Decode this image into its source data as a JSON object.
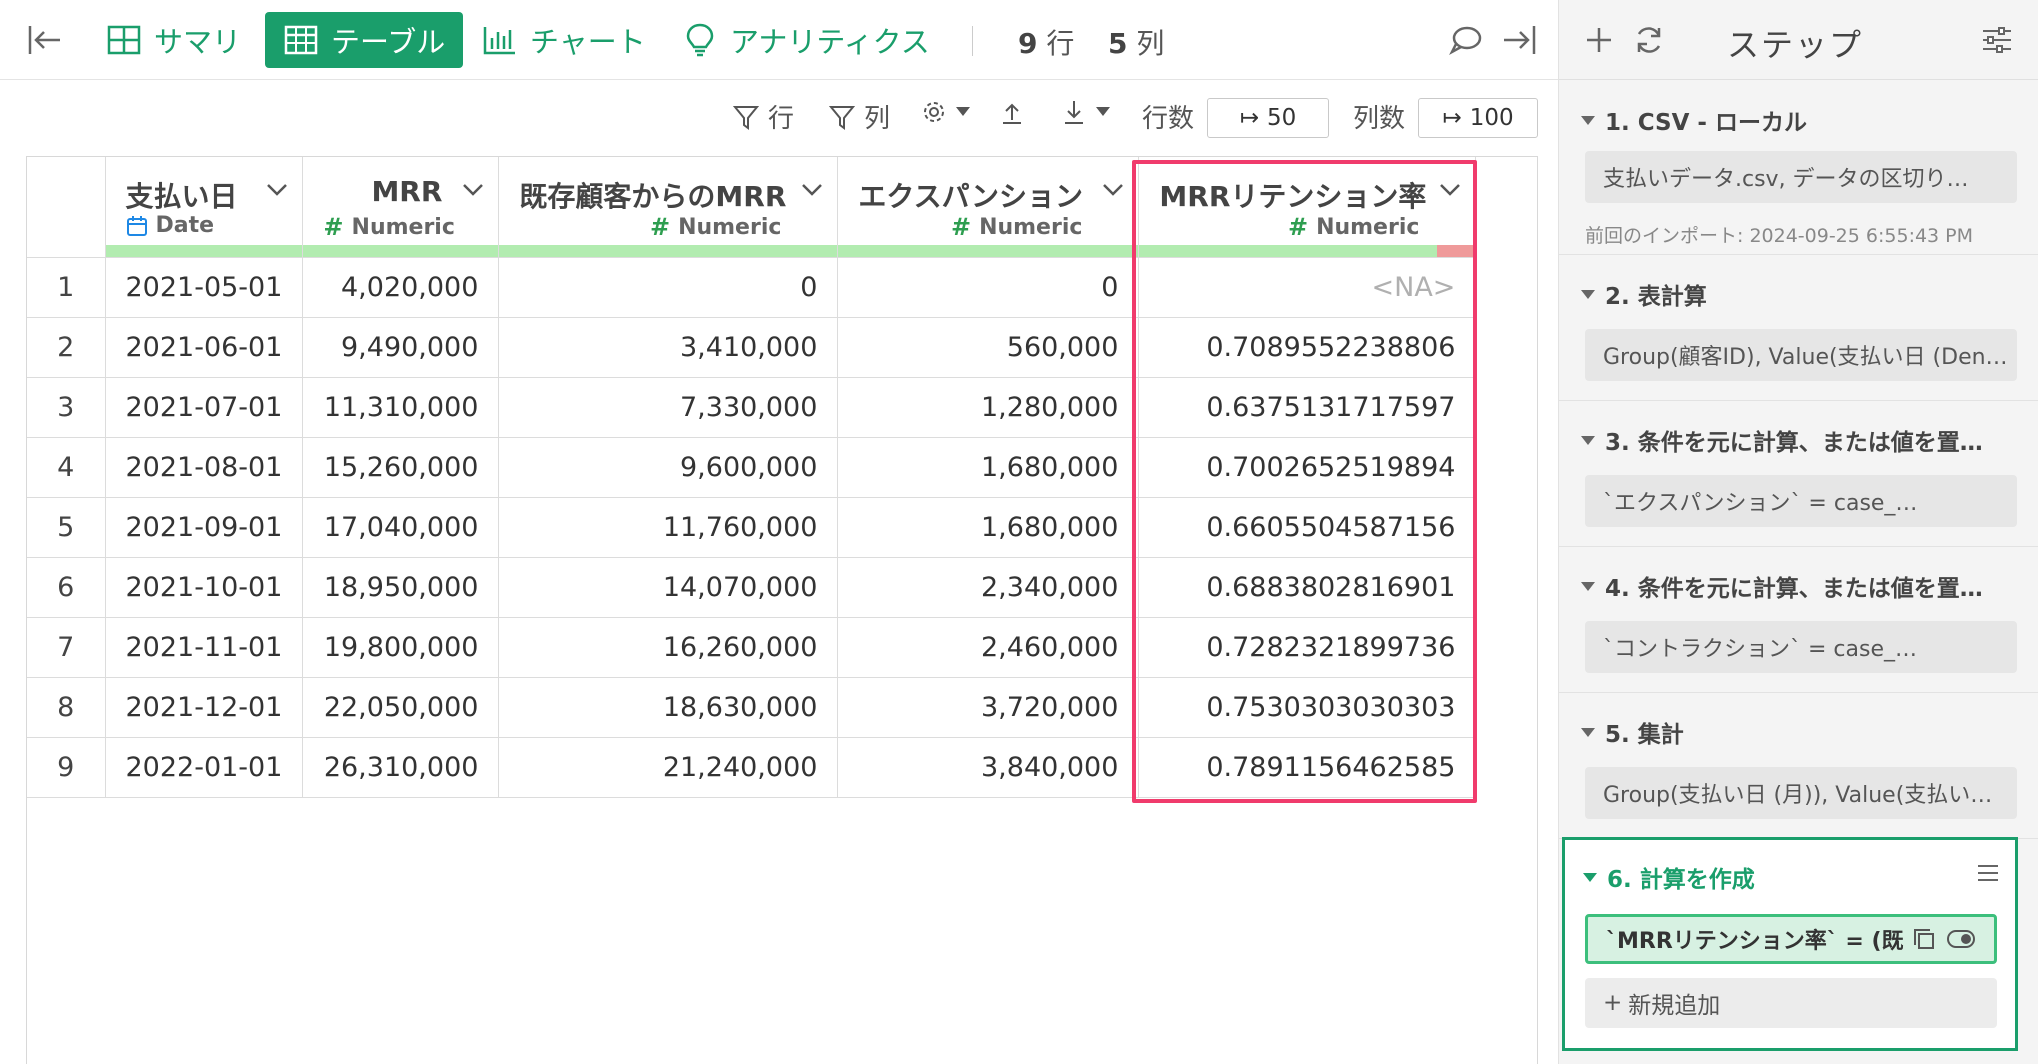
{
  "toolbar": {
    "summary_label": "サマリ",
    "table_label": "テーブル",
    "chart_label": "チャート",
    "analytics_label": "アナリティクス",
    "rows_count": "9",
    "rows_unit": "行",
    "cols_count": "5",
    "cols_unit": "列"
  },
  "filterbar": {
    "row_filter": "行",
    "col_filter": "列",
    "rows_label": "行数",
    "rows_value": "50",
    "cols_label": "列数",
    "cols_value": "100"
  },
  "table": {
    "columns": [
      {
        "name": "支払い日",
        "type": "Date"
      },
      {
        "name": "MRR",
        "type": "Numeric"
      },
      {
        "name": "既存顧客からのMRR",
        "type": "Numeric"
      },
      {
        "name": "エクスパンション",
        "type": "Numeric"
      },
      {
        "name": "MRRリテンション率",
        "type": "Numeric"
      }
    ],
    "rows": [
      [
        "1",
        "2021-05-01",
        "4,020,000",
        "0",
        "0",
        "<NA>"
      ],
      [
        "2",
        "2021-06-01",
        "9,490,000",
        "3,410,000",
        "560,000",
        "0.7089552238806"
      ],
      [
        "3",
        "2021-07-01",
        "11,310,000",
        "7,330,000",
        "1,280,000",
        "0.6375131717597"
      ],
      [
        "4",
        "2021-08-01",
        "15,260,000",
        "9,600,000",
        "1,680,000",
        "0.7002652519894"
      ],
      [
        "5",
        "2021-09-01",
        "17,040,000",
        "11,760,000",
        "1,680,000",
        "0.6605504587156"
      ],
      [
        "6",
        "2021-10-01",
        "18,950,000",
        "14,070,000",
        "2,340,000",
        "0.6883802816901"
      ],
      [
        "7",
        "2021-11-01",
        "19,800,000",
        "16,260,000",
        "2,460,000",
        "0.7282321899736"
      ],
      [
        "8",
        "2021-12-01",
        "22,050,000",
        "18,630,000",
        "3,720,000",
        "0.7530303030303"
      ],
      [
        "9",
        "2022-01-01",
        "26,310,000",
        "21,240,000",
        "3,840,000",
        "0.7891156462585"
      ]
    ]
  },
  "sidebar": {
    "title": "ステップ",
    "steps": [
      {
        "title": "1. CSV - ローカル",
        "body": "支払いデータ.csv, データの区切り…",
        "meta": "前回のインポート: 2024-09-25 6:55:43 PM"
      },
      {
        "title": "2. 表計算",
        "body": "Group(顧客ID), Value(支払い日 (Den…"
      },
      {
        "title": "3. 条件を元に計算、または値を置…",
        "body": "`エクスパンション` = case_…"
      },
      {
        "title": "4. 条件を元に計算、または値を置…",
        "body": "`コントラクション` = case_…"
      },
      {
        "title": "5. 集計",
        "body": "Group(支払い日 (月)), Value(支払い…"
      },
      {
        "title": "6. 計算を作成",
        "body": "`MRRリテンション率` = (既…"
      }
    ],
    "add_new_label": "新規追加"
  },
  "colors": {
    "accent": "#1a9e6b",
    "highlight": "#f03b6c",
    "quality_ok": "#b2ecb0",
    "quality_na": "#ef9a9a"
  }
}
